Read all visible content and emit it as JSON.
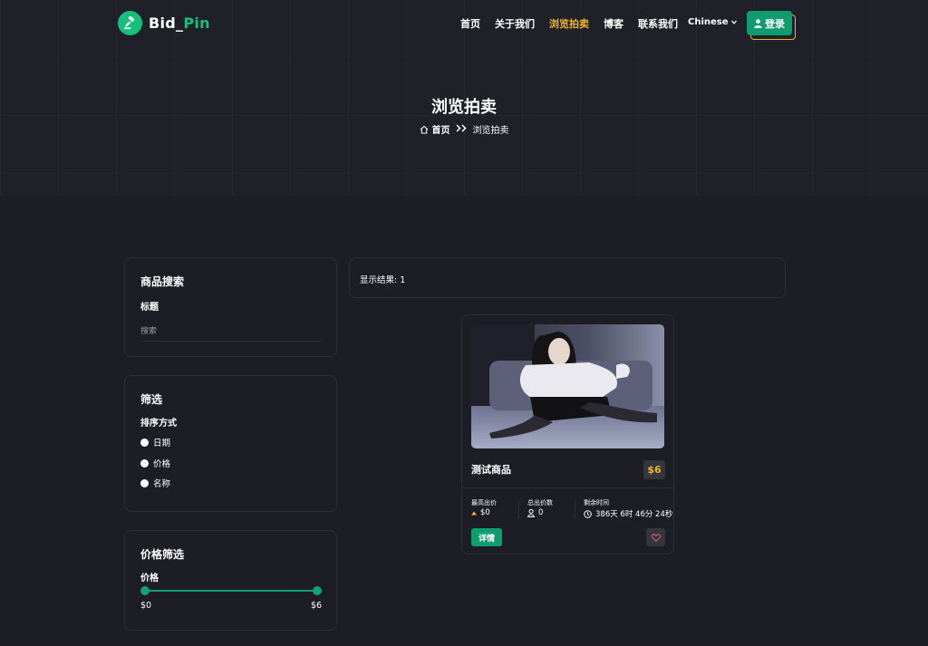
{
  "brand": {
    "name_part1": "Bid_",
    "name_part2": "Pin"
  },
  "nav": {
    "items": [
      {
        "label": "首页",
        "active": false
      },
      {
        "label": "关于我们",
        "active": false
      },
      {
        "label": "浏览拍卖",
        "active": true
      },
      {
        "label": "博客",
        "active": false
      },
      {
        "label": "联系我们",
        "active": false
      }
    ],
    "language": "Chinese",
    "login_label": "登录"
  },
  "hero": {
    "title": "浏览拍卖",
    "breadcrumb_home": "首页",
    "breadcrumb_current": "浏览拍卖"
  },
  "sidebar": {
    "search": {
      "title": "商品搜索",
      "field_label": "标题",
      "placeholder": "搜索"
    },
    "filter": {
      "title": "筛选",
      "sort_label": "排序方式",
      "options": [
        "日期",
        "价格",
        "名称"
      ]
    },
    "price": {
      "title": "价格筛选",
      "label": "价格",
      "min": "$0",
      "max": "$6"
    }
  },
  "results": {
    "text": "显示结果: 1"
  },
  "product": {
    "name": "测试商品",
    "price": "$6",
    "highest_bid_label": "最高出价",
    "highest_bid": "$0",
    "bid_count_label": "总出价数",
    "bid_count": "0",
    "time_left_label": "剩余时间",
    "time_left": "386天 6时 46分 24秒",
    "details_label": "详情"
  },
  "colors": {
    "accent_green": "#0f9d6f",
    "accent_gold": "#f0b429",
    "background": "#1d1e25"
  }
}
